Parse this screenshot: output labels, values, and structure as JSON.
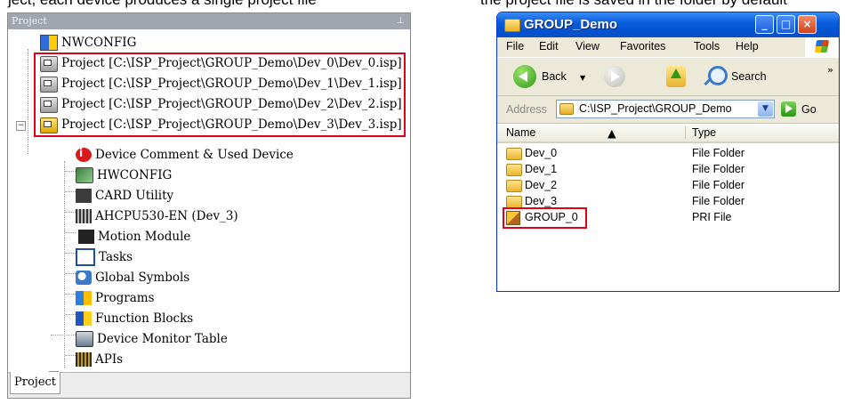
{
  "top_strip": {
    "left_caption": "ject, each device produces a single project file",
    "right_caption": "the project file is saved in the folder by default"
  },
  "project_panel": {
    "title": "Project",
    "pin": "⊥",
    "tab": "Project",
    "items": [
      {
        "label": "NWCONFIG",
        "icon": "nwconfig-icon"
      },
      {
        "label": "Project [C:\\ISP_Project\\GROUP_Demo\\Dev_0\\Dev_0.isp]",
        "icon": "project-icon"
      },
      {
        "label": "Project [C:\\ISP_Project\\GROUP_Demo\\Dev_1\\Dev_1.isp]",
        "icon": "project-icon"
      },
      {
        "label": "Project [C:\\ISP_Project\\GROUP_Demo\\Dev_2\\Dev_2.isp]",
        "icon": "project-icon"
      },
      {
        "label": "Project [C:\\ISP_Project\\GROUP_Demo\\Dev_3\\Dev_3.isp]",
        "icon": "project-active-icon"
      },
      {
        "label": "Device Comment & Used Device",
        "icon": "device-comment-icon"
      },
      {
        "label": "HWCONFIG",
        "icon": "hwconfig-icon"
      },
      {
        "label": "CARD Utility",
        "icon": "card-utility-icon"
      },
      {
        "label": "AHCPU530-EN  (Dev_3)",
        "icon": "cpu-icon"
      },
      {
        "label": "Motion Module",
        "icon": "motion-module-icon"
      },
      {
        "label": "Tasks",
        "icon": "tasks-icon"
      },
      {
        "label": "Global Symbols",
        "icon": "global-symbols-icon"
      },
      {
        "label": "Programs",
        "icon": "programs-icon"
      },
      {
        "label": "Function Blocks",
        "icon": "function-blocks-icon"
      },
      {
        "label": "Device Monitor Table",
        "icon": "device-monitor-icon"
      },
      {
        "label": "APIs",
        "icon": "apis-icon"
      }
    ],
    "expander_minus": "−",
    "expander_plus": "+"
  },
  "explorer": {
    "title": "GROUP_Demo",
    "title_buttons": {
      "minimize": "_",
      "maximize": "□",
      "close": "×"
    },
    "menu": [
      "File",
      "Edit",
      "View",
      "Favorites",
      "Tools",
      "Help"
    ],
    "toolbar": {
      "back": "Back",
      "search": "Search",
      "more": "»",
      "caret": "▼"
    },
    "address": {
      "label": "Address",
      "value": "C:\\ISP_Project\\GROUP_Demo",
      "go": "Go",
      "dropdown": "▼"
    },
    "columns": {
      "name": "Name",
      "type": "Type",
      "sort_indicator": "▲"
    },
    "files": [
      {
        "name": "Dev_0",
        "type": "File Folder",
        "icon": "folder-icon"
      },
      {
        "name": "Dev_1",
        "type": "File Folder",
        "icon": "folder-icon"
      },
      {
        "name": "Dev_2",
        "type": "File Folder",
        "icon": "folder-icon"
      },
      {
        "name": "Dev_3",
        "type": "File Folder",
        "icon": "folder-icon"
      },
      {
        "name": "GROUP_0",
        "type": "PRI File",
        "icon": "group-project-file-icon"
      }
    ]
  },
  "colors": {
    "highlight_box": "#e0001b",
    "xp_title_blue": "#0453d0",
    "xp_face": "#ece9d8"
  }
}
